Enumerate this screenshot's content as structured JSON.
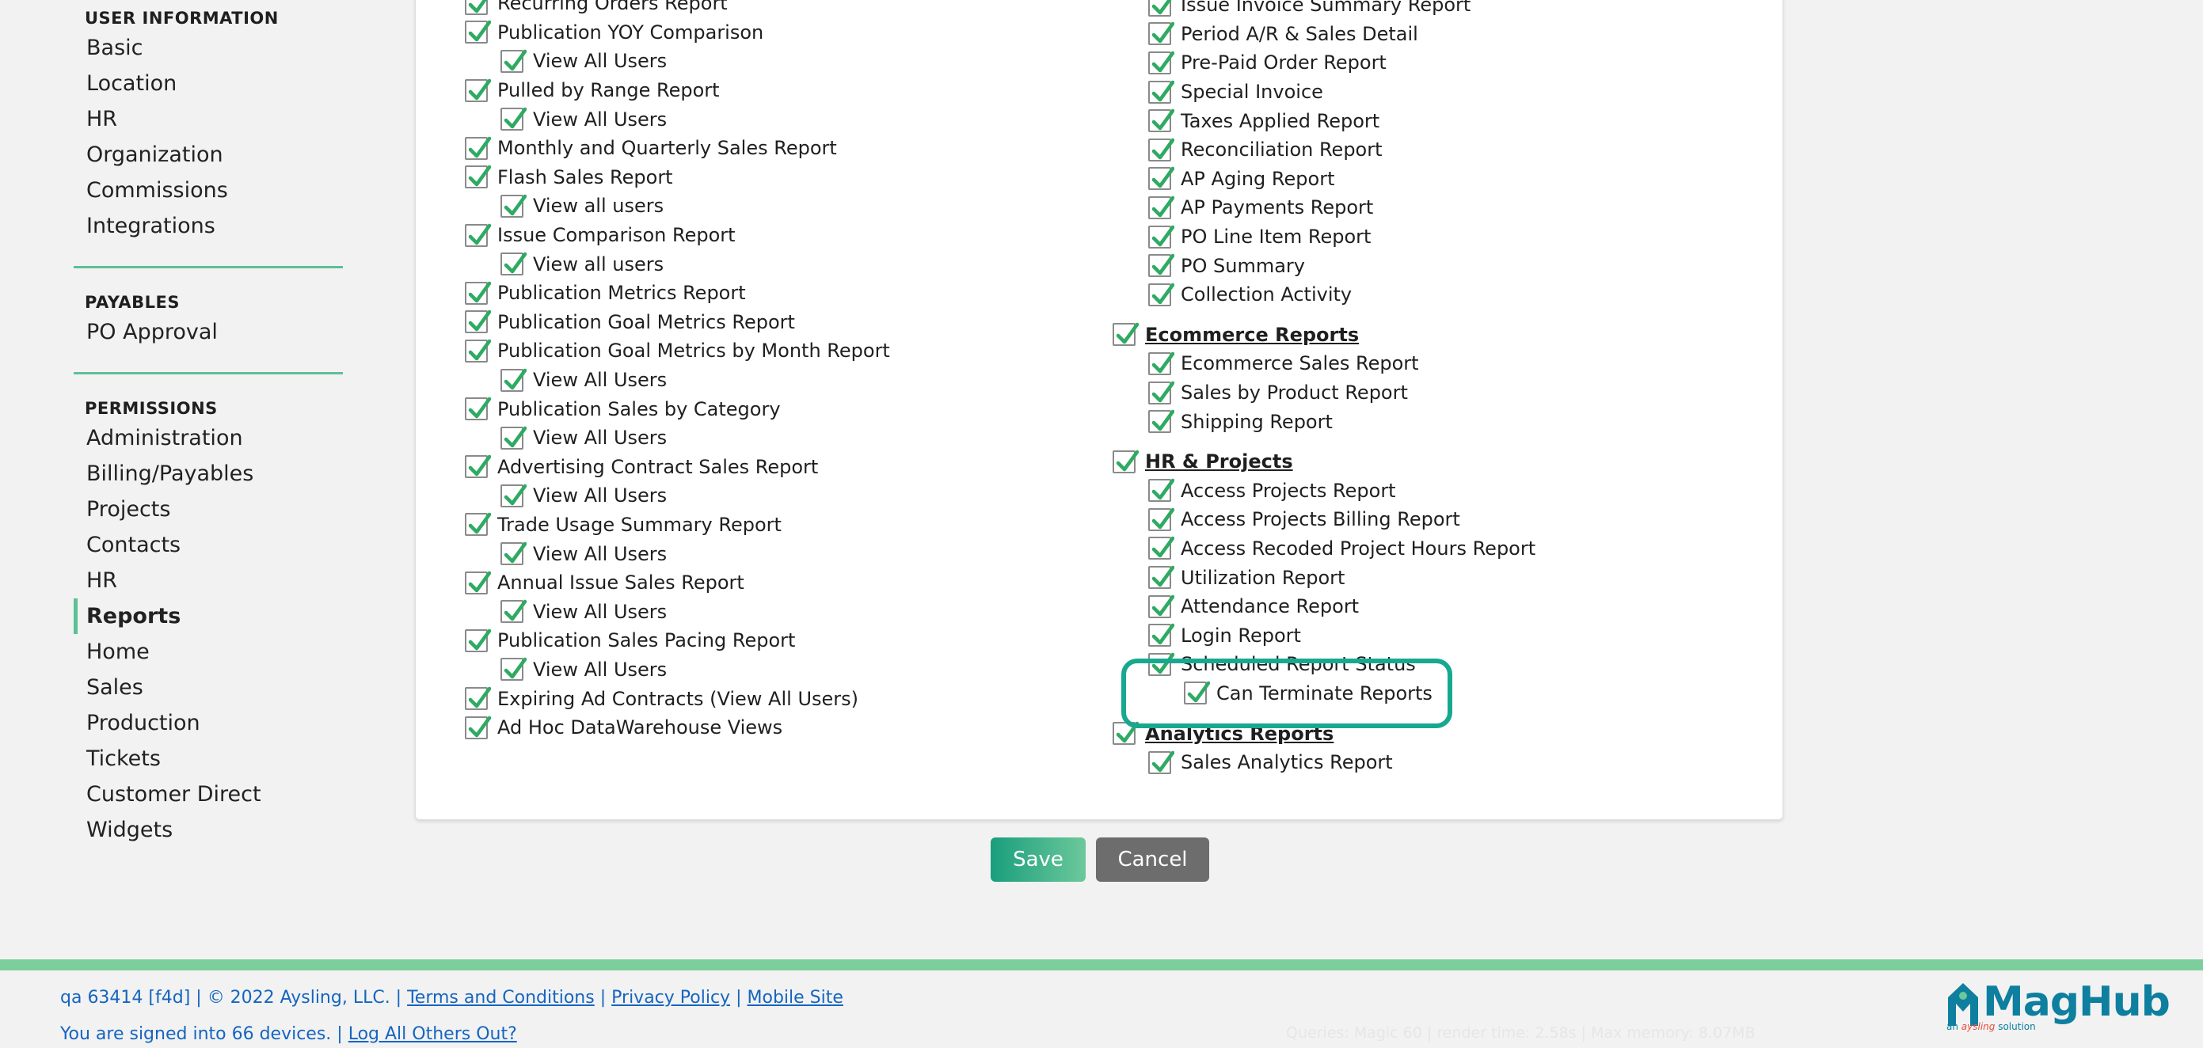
{
  "sidebar": {
    "groups": [
      {
        "header": "USER INFORMATION",
        "items": [
          "Basic",
          "Location",
          "HR",
          "Organization",
          "Commissions",
          "Integrations"
        ]
      },
      {
        "header": "PAYABLES",
        "items": [
          "PO Approval"
        ]
      },
      {
        "header": "PERMISSIONS",
        "items": [
          "Administration",
          "Billing/Payables",
          "Projects",
          "Contacts",
          "HR",
          "Reports",
          "Home",
          "Sales",
          "Production",
          "Tickets",
          "Customer Direct",
          "Widgets"
        ],
        "active": "Reports"
      }
    ]
  },
  "left_column": [
    {
      "label": "Recurring Orders Report",
      "level": 0,
      "checked": true
    },
    {
      "label": "Publication YOY Comparison",
      "level": 0,
      "checked": true
    },
    {
      "label": "View All Users",
      "level": 1,
      "checked": true
    },
    {
      "label": "Pulled by Range Report",
      "level": 0,
      "checked": true
    },
    {
      "label": "View All Users",
      "level": 1,
      "checked": true
    },
    {
      "label": "Monthly and Quarterly Sales Report",
      "level": 0,
      "checked": true
    },
    {
      "label": "Flash Sales Report",
      "level": 0,
      "checked": true
    },
    {
      "label": "View all users",
      "level": 1,
      "checked": true
    },
    {
      "label": "Issue Comparison Report",
      "level": 0,
      "checked": true
    },
    {
      "label": "View all users",
      "level": 1,
      "checked": true
    },
    {
      "label": "Publication Metrics Report",
      "level": 0,
      "checked": true
    },
    {
      "label": "Publication Goal Metrics Report",
      "level": 0,
      "checked": true
    },
    {
      "label": "Publication Goal Metrics by Month Report",
      "level": 0,
      "checked": true
    },
    {
      "label": "View All Users",
      "level": 1,
      "checked": true
    },
    {
      "label": "Publication Sales by Category",
      "level": 0,
      "checked": true
    },
    {
      "label": "View All Users",
      "level": 1,
      "checked": true
    },
    {
      "label": "Advertising Contract Sales Report",
      "level": 0,
      "checked": true
    },
    {
      "label": "View All Users",
      "level": 1,
      "checked": true
    },
    {
      "label": "Trade Usage Summary Report",
      "level": 0,
      "checked": true
    },
    {
      "label": "View All Users",
      "level": 1,
      "checked": true
    },
    {
      "label": "Annual Issue Sales Report",
      "level": 0,
      "checked": true
    },
    {
      "label": "View All Users",
      "level": 1,
      "checked": true
    },
    {
      "label": "Publication Sales Pacing Report",
      "level": 0,
      "checked": true
    },
    {
      "label": "View All Users",
      "level": 1,
      "checked": true
    },
    {
      "label": "Expiring Ad Contracts (View All Users)",
      "level": 0,
      "checked": true
    },
    {
      "label": "Ad Hoc DataWarehouse Views",
      "level": 0,
      "checked": true
    }
  ],
  "right_column": [
    {
      "label": "Issue Invoice Summary Report",
      "level": 1,
      "checked": true
    },
    {
      "label": "Period A/R & Sales Detail",
      "level": 1,
      "checked": true
    },
    {
      "label": "Pre-Paid Order Report",
      "level": 1,
      "checked": true
    },
    {
      "label": "Special Invoice",
      "level": 1,
      "checked": true
    },
    {
      "label": "Taxes Applied Report",
      "level": 1,
      "checked": true
    },
    {
      "label": "Reconciliation Report",
      "level": 1,
      "checked": true
    },
    {
      "label": "AP Aging Report",
      "level": 1,
      "checked": true
    },
    {
      "label": "AP Payments Report",
      "level": 1,
      "checked": true
    },
    {
      "label": "PO Line Item Report",
      "level": 1,
      "checked": true
    },
    {
      "label": "PO Summary",
      "level": 1,
      "checked": true
    },
    {
      "label": "Collection Activity",
      "level": 1,
      "checked": true
    },
    {
      "label": "Ecommerce Reports",
      "level": 0,
      "section": true,
      "checked": true
    },
    {
      "label": "Ecommerce Sales Report",
      "level": 1,
      "checked": true
    },
    {
      "label": "Sales by Product Report",
      "level": 1,
      "checked": true
    },
    {
      "label": "Shipping Report",
      "level": 1,
      "checked": true
    },
    {
      "label": "HR & Projects",
      "level": 0,
      "section": true,
      "checked": true
    },
    {
      "label": "Access Projects Report",
      "level": 1,
      "checked": true
    },
    {
      "label": "Access Projects Billing Report",
      "level": 1,
      "checked": true
    },
    {
      "label": "Access Recoded Project Hours Report",
      "level": 1,
      "checked": true
    },
    {
      "label": "Utilization Report",
      "level": 1,
      "checked": true
    },
    {
      "label": "Attendance Report",
      "level": 1,
      "checked": true
    },
    {
      "label": "Login Report",
      "level": 1,
      "checked": true
    },
    {
      "label": "Scheduled Report Status",
      "level": 1,
      "checked": true
    },
    {
      "label": "Can Terminate Reports",
      "level": 2,
      "checked": true
    },
    {
      "label": "Analytics Reports",
      "level": 0,
      "section": true,
      "checked": true
    },
    {
      "label": "Sales Analytics Report",
      "level": 1,
      "checked": true
    }
  ],
  "buttons": {
    "save": "Save",
    "cancel": "Cancel"
  },
  "footer": {
    "build": "qa 63414 [f4d] | © 2022 Aysling, LLC. |",
    "terms": "Terms and Conditions",
    "sep1": "|",
    "privacy": "Privacy Policy",
    "sep2": "|",
    "mobile": "Mobile Site",
    "signed_in": "You are signed into 66 devices. |",
    "logout_others": "Log All Others Out?",
    "debug": "Queries: Magic 60 | render time: 2.58s | Max memory: 8.07MB"
  },
  "logo": {
    "name": "MagHub",
    "tagline_prefix": "an ",
    "tagline_brand": "aysling",
    "tagline_suffix": " solution"
  },
  "colors": {
    "accent": "#5cc096",
    "highlight": "#17a890",
    "link": "#1565c0",
    "save": "#1a9e7d",
    "cancel": "#6d6d6d"
  }
}
